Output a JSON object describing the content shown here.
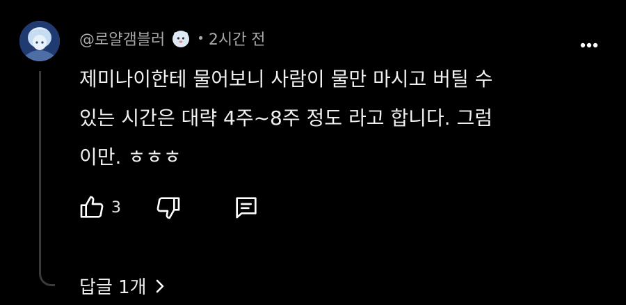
{
  "comment": {
    "author": "@로얄갬블러",
    "separator": "•",
    "time": "2시간 전",
    "text": "제미나이한테 물어보니 사람이 물만 마시고 버틸 수\n있는 시간은 대략 4주~8주 정도 라고 합니다. 그럼\n이만. ㅎㅎㅎ",
    "likes": "3",
    "replies_label": "답글 1개"
  },
  "icons": {
    "avatar": "avatar",
    "badge": "member-badge-icon",
    "more": "more-dots-icon",
    "like": "thumbs-up-icon",
    "dislike": "thumbs-down-icon",
    "reply": "comment-icon",
    "chevron": "chevron-right-icon"
  },
  "colors": {
    "background": "#000000",
    "text": "#f1f1f1",
    "meta": "#aaaaaa",
    "thread_line": "#3a3a3a"
  }
}
